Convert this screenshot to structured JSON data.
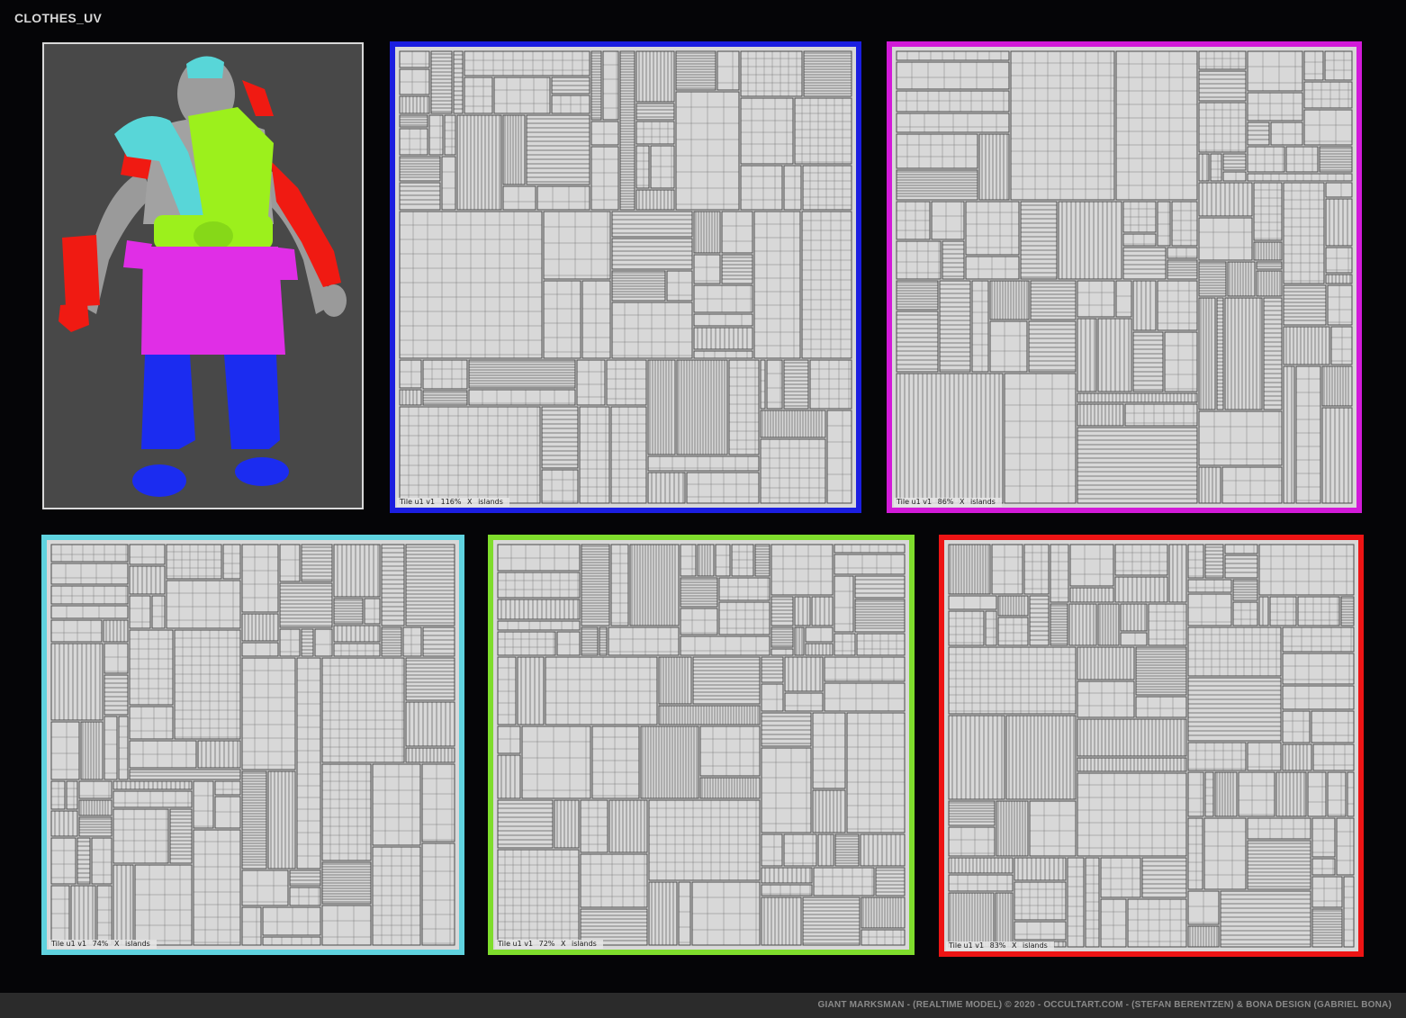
{
  "header": {
    "title": "CLOTHES_UV"
  },
  "viewport": {
    "alt": "character"
  },
  "panels": [
    {
      "id": "blue",
      "color": "#1b1ee0",
      "tile": "Tile u1  v1",
      "zoom": "116%",
      "x_label": "X",
      "islands": "islands"
    },
    {
      "id": "magenta",
      "color": "#d21ad8",
      "tile": "Tile u1  v1",
      "zoom": "86%",
      "x_label": "X",
      "islands": "islands"
    },
    {
      "id": "cyan",
      "color": "#5fd3df",
      "tile": "Tile u1  v1",
      "zoom": "74%",
      "x_label": "X",
      "islands": "islands"
    },
    {
      "id": "green",
      "color": "#7fdd2c",
      "tile": "Tile u1  v1",
      "zoom": "72%",
      "x_label": "X",
      "islands": "islands"
    },
    {
      "id": "red",
      "color": "#ee1414",
      "tile": "Tile u1  v1",
      "zoom": "83%",
      "x_label": "X",
      "islands": "islands"
    }
  ],
  "footer": {
    "credit": "GIANT MARKSMAN - (REALTIME MODEL) © 2020   -   OCCULTART.COM - (STEFAN BERENTZEN)  &  BONA DESIGN (GABRIEL BONA)"
  },
  "colors": {
    "background": "#050507",
    "uv_fill": "#d8d8d8",
    "uv_line": "#4a4a4a",
    "armor_cyan": "#58d6d8",
    "tunic_green": "#9cf01c",
    "skirt_magenta": "#e02ee6",
    "pants_blue": "#1b2cf0",
    "armor_red": "#f01a12"
  }
}
